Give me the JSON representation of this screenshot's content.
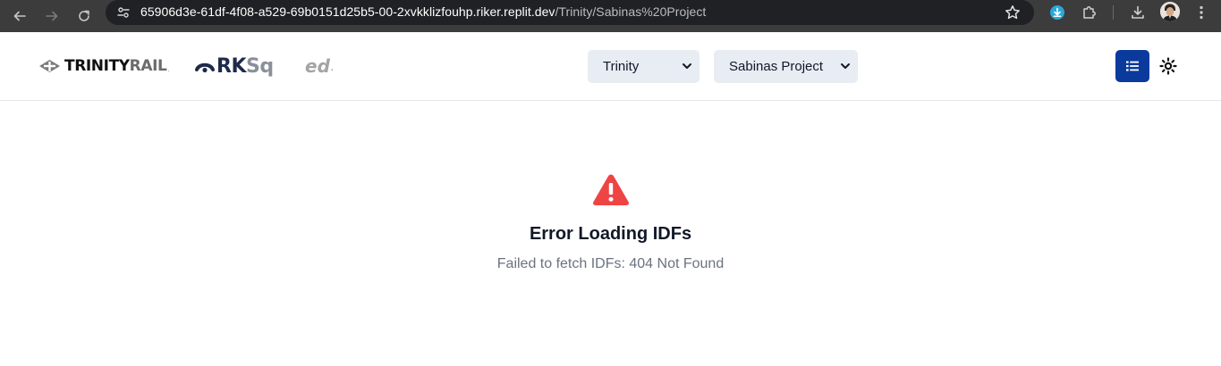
{
  "browser": {
    "url_host": "65906d3e-61df-4f08-a529-69b0151d25b5-00-2xvkklizfouhp.riker.replit.dev",
    "url_path": "/Trinity/Sabinas%20Project",
    "icons": [
      "back-arrow-icon",
      "forward-arrow-icon",
      "reload-icon",
      "site-info-icon",
      "bookmark-star-icon",
      "download-extension-icon",
      "extensions-puzzle-icon",
      "downloads-icon",
      "profile-avatar",
      "menu-kebab-icon"
    ]
  },
  "header": {
    "logos": {
      "trinity_main": "TRINITY",
      "trinity_rail": "RAIL",
      "trinity_mark": ".",
      "rksq_bold": "RK",
      "rksq_light": "Sq",
      "ed": "ed",
      "ed_dot": "."
    },
    "company_select": {
      "value": "Trinity"
    },
    "project_select": {
      "value": "Sabinas Project"
    },
    "list_view_button": {
      "icon": "list-icon",
      "color": "#0a3a9c"
    },
    "theme_toggle": {
      "icon": "sun-icon"
    }
  },
  "error": {
    "icon": "warning-triangle-icon",
    "icon_color": "#ef4444",
    "title": "Error Loading IDFs",
    "message": "Failed to fetch IDFs: 404 Not Found"
  }
}
